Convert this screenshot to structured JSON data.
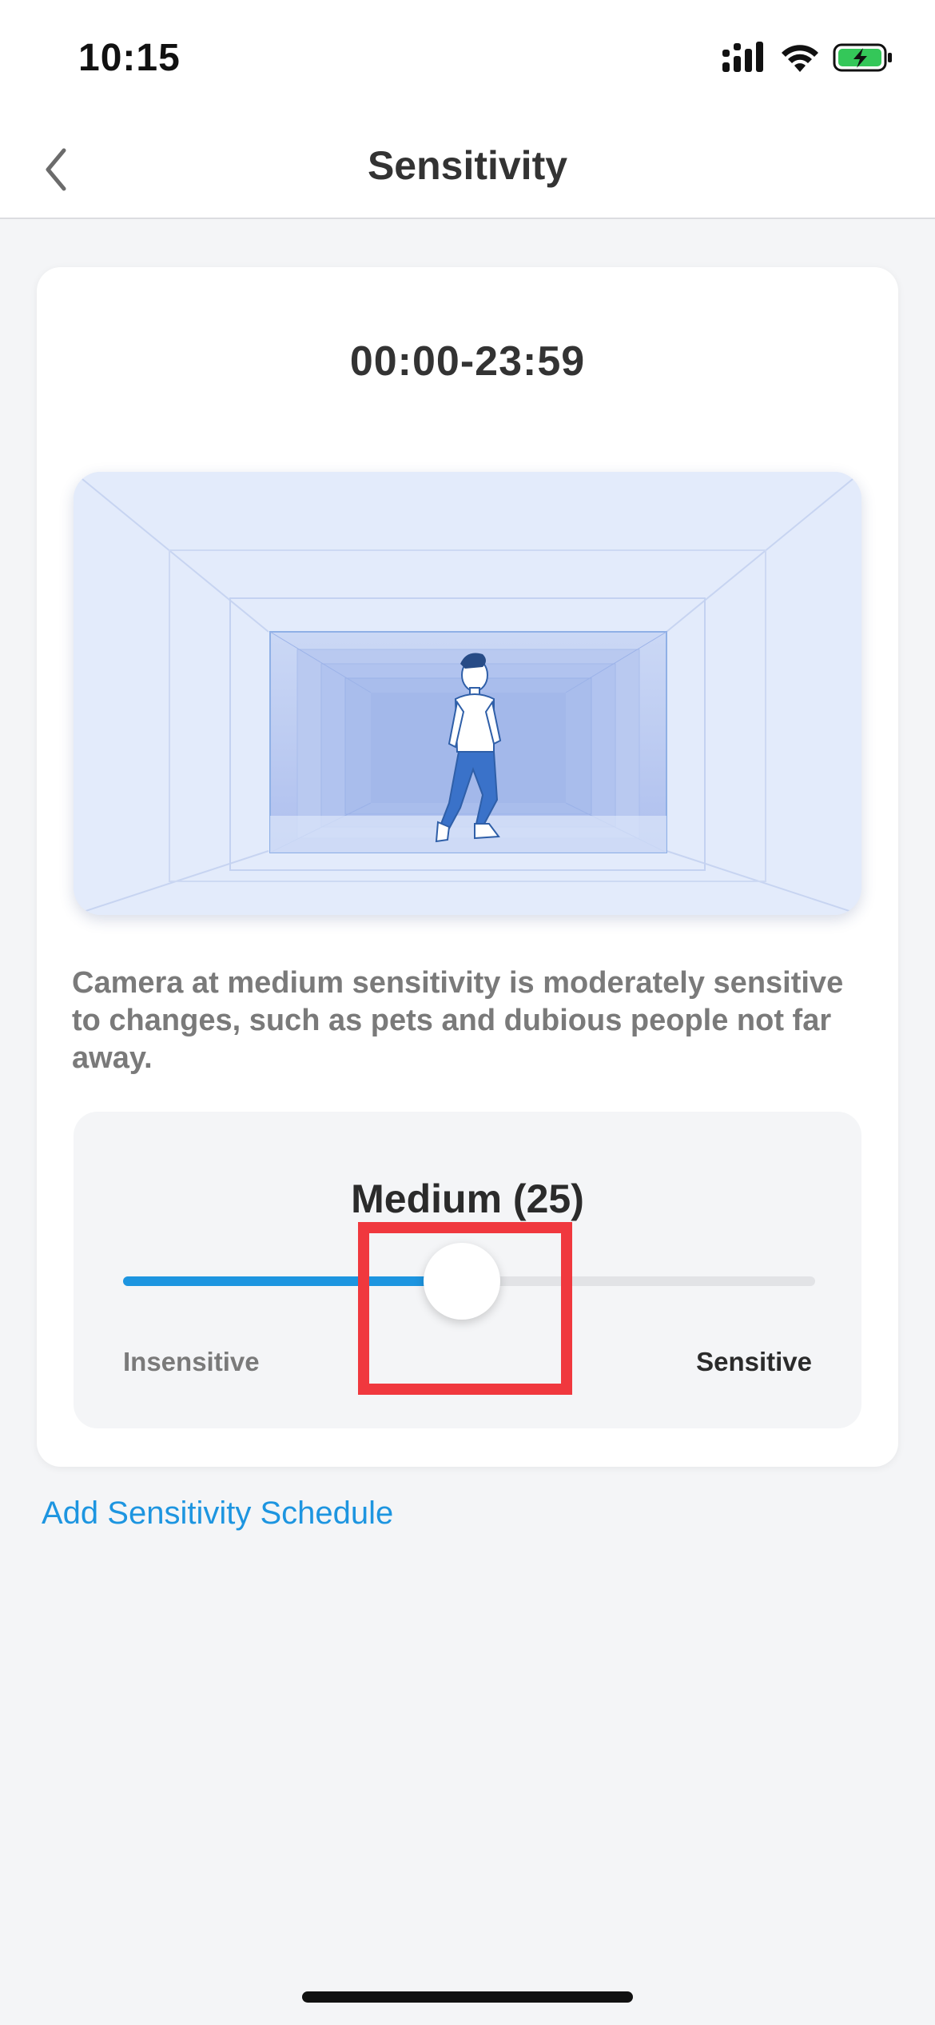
{
  "status_bar": {
    "time": "10:15"
  },
  "nav": {
    "title": "Sensitivity"
  },
  "card": {
    "schedule_time": "00:00-23:59",
    "description": "Camera at medium sensitivity is moderately sensitive to changes, such as pets and dubious people not far away.",
    "slider": {
      "level_label": "Medium (25)",
      "min_label": "Insensitive",
      "max_label": "Sensitive",
      "value_fraction": 0.49
    }
  },
  "add_schedule_link": "Add Sensitivity Schedule",
  "colors": {
    "accent": "#1d95e0",
    "highlight": "#f0383e",
    "battery": "#34c759"
  }
}
